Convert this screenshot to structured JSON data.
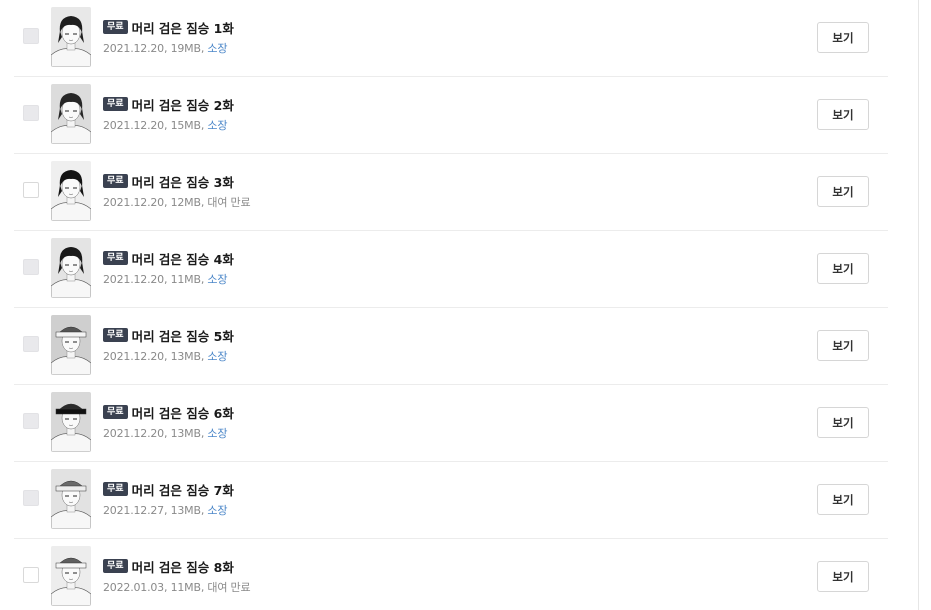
{
  "episodes": [
    {
      "badge": "무료",
      "title": "머리 검은 짐승 1화",
      "date": "2021.12.20",
      "size": "19MB",
      "status": "소장",
      "status_type": "owned",
      "checkbox_enabled": false,
      "button_label": "보기",
      "thumbnail_icon": "episode-cover"
    },
    {
      "badge": "무료",
      "title": "머리 검은 짐승 2화",
      "date": "2021.12.20",
      "size": "15MB",
      "status": "소장",
      "status_type": "owned",
      "checkbox_enabled": false,
      "button_label": "보기",
      "thumbnail_icon": "episode-cover"
    },
    {
      "badge": "무료",
      "title": "머리 검은 짐승 3화",
      "date": "2021.12.20",
      "size": "12MB",
      "status": "대여 만료",
      "status_type": "expired",
      "checkbox_enabled": true,
      "button_label": "보기",
      "thumbnail_icon": "episode-cover"
    },
    {
      "badge": "무료",
      "title": "머리 검은 짐승 4화",
      "date": "2021.12.20",
      "size": "11MB",
      "status": "소장",
      "status_type": "owned",
      "checkbox_enabled": false,
      "button_label": "보기",
      "thumbnail_icon": "episode-cover"
    },
    {
      "badge": "무료",
      "title": "머리 검은 짐승 5화",
      "date": "2021.12.20",
      "size": "13MB",
      "status": "소장",
      "status_type": "owned",
      "checkbox_enabled": false,
      "button_label": "보기",
      "thumbnail_icon": "episode-cover"
    },
    {
      "badge": "무료",
      "title": "머리 검은 짐승 6화",
      "date": "2021.12.20",
      "size": "13MB",
      "status": "소장",
      "status_type": "owned",
      "checkbox_enabled": false,
      "button_label": "보기",
      "thumbnail_icon": "episode-cover"
    },
    {
      "badge": "무료",
      "title": "머리 검은 짐승 7화",
      "date": "2021.12.27",
      "size": "13MB",
      "status": "소장",
      "status_type": "owned",
      "checkbox_enabled": false,
      "button_label": "보기",
      "thumbnail_icon": "episode-cover"
    },
    {
      "badge": "무료",
      "title": "머리 검은 짐승 8화",
      "date": "2022.01.03",
      "size": "11MB",
      "status": "대여 만료",
      "status_type": "expired",
      "checkbox_enabled": true,
      "button_label": "보기",
      "thumbnail_icon": "episode-cover"
    }
  ],
  "colors": {
    "badge_bg": "#3a4150",
    "owned_status": "#4a86c8",
    "meta_text": "#8a8a8a",
    "title_text": "#1a1a1a",
    "divider": "#ececec"
  }
}
